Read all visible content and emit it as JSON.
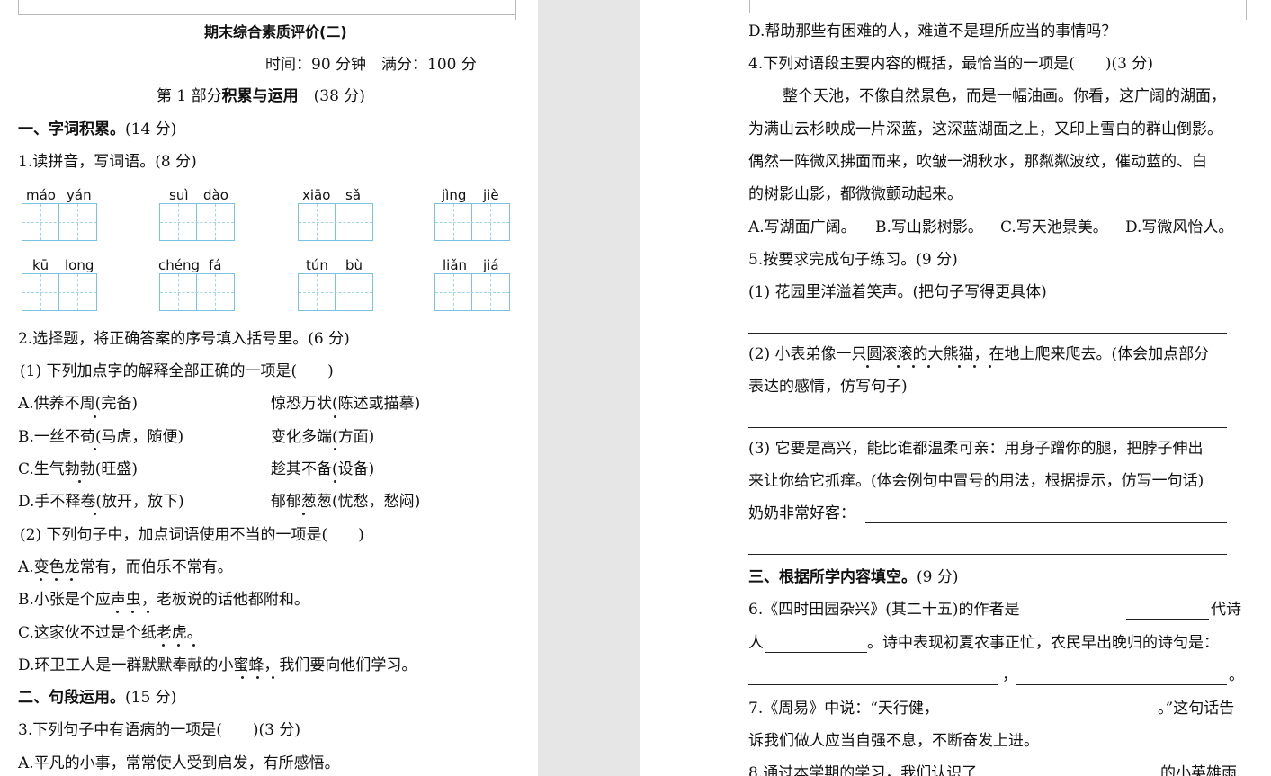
{
  "left": {
    "title": "期末综合素质评价(二)",
    "time_info": "时间：90 分钟　满分：100 分",
    "part1_prefix": "第 1 部分",
    "part1_bold": "积累与运用",
    "part1_score": "(38 分)",
    "sec1_bold": "一、字词积累。",
    "sec1_score": "(14 分)",
    "q1": "1.读拼音，写词语。(8 分)",
    "pinyin": [
      {
        "a": "máo",
        "b": "yán"
      },
      {
        "a": "suì",
        "b": "dào"
      },
      {
        "a": "xiāo",
        "b": "sǎ"
      },
      {
        "a": "jìng",
        "b": "jiè"
      },
      {
        "a": "kū",
        "b": "long"
      },
      {
        "a": "chéng",
        "b": "fá"
      },
      {
        "a": "tún",
        "b": "bù"
      },
      {
        "a": "liǎn",
        "b": "jiá"
      }
    ],
    "q2": "2.选择题，将正确答案的序号填入括号里。(6 分)",
    "q2_1": "(1) 下列加点字的解释全部正确的一项是(　　)",
    "q2_1_options": [
      {
        "l": "A.供养不周(完备)",
        "r": "惊恐万状(陈述或描摹)"
      },
      {
        "l": "B.一丝不苟(马虎，随便)",
        "r": "变化多端(方面)"
      },
      {
        "l": "C.生气勃勃(旺盛)",
        "r": "趁其不备(设备)"
      },
      {
        "l": "D.手不释卷(放开，放下)",
        "r": "郁郁葱葱(忧愁，愁闷)"
      }
    ],
    "q2_2": "(2) 下列句子中，加点词语使用不当的一项是(　　)",
    "q2_2_options": [
      "A.变色龙常有，而伯乐不常有。",
      "B.小张是个应声虫，老板说的话他都附和。",
      "C.这家伙不过是个纸老虎。",
      "D.环卫工人是一群默默奉献的小蜜蜂，我们要向他们学习。"
    ],
    "sec2_bold": "二、句段运用。",
    "sec2_score": "(15 分)",
    "q3": "3.下列句子中有语病的一项是(　　)(3 分)",
    "q3_a": "A.平凡的小事，常常使人受到启发，有所感悟。"
  },
  "right": {
    "q3_d": "D.帮助那些有困难的人，难道不是理所应当的事情吗？",
    "q4": "4.下列对语段主要内容的概括，最恰当的一项是(　　)(3 分)",
    "passage": [
      "整个天池，不像自然景色，而是一幅油画。你看，这广阔的湖面，",
      "为满山云杉映成一片深蓝，这深蓝湖面之上，又印上雪白的群山倒影。",
      "偶然一阵微风拂面而来，吹皱一湖秋水，那粼粼波纹，催动蓝的、白",
      "的树影山影，都微微颤动起来。"
    ],
    "q4_options": [
      "A.写湖面广阔。",
      "B.写山影树影。",
      "C.写天池景美。",
      "D.写微风怡人。"
    ],
    "q5": "5.按要求完成句子练习。(9 分)",
    "q5_1": "(1) 花园里洋溢着笑声。(把句子写得更具体)",
    "q5_2_a": "(2) 小表弟像一只圆滚滚的大熊猫，在地上爬来爬去。(体会加点部分",
    "q5_2_b": "表达的感情，仿写句子)",
    "q5_3_a": "(3) 它要是高兴，能比谁都温柔可亲：用身子蹭你的腿，把脖子伸出",
    "q5_3_b": "来让你给它抓痒。(体会例句中冒号的用法，根据提示，仿写一句话)",
    "q5_3_c": "奶奶非常好客：",
    "sec3_bold": "三、根据所学内容填空。",
    "sec3_score": "(9 分)",
    "q6_a": "6.《四时田园杂兴》(其二十五)的作者是",
    "q6_a2": "代诗",
    "q6_b": "人",
    "q6_b2": "。诗中表现初夏农事正忙，农民早出晚归的诗句是：",
    "q6_c_sep": "，",
    "q6_c_end": "。",
    "q7_a": "7.《周易》中说：“天行健，",
    "q7_a2": "。”这句话告",
    "q7_b": "诉我们做人应当自强不息，不断奋发上进。",
    "q8_a": "8.通过本学期的学习，我们认识了",
    "q8_a2": "的小英雄雨"
  }
}
